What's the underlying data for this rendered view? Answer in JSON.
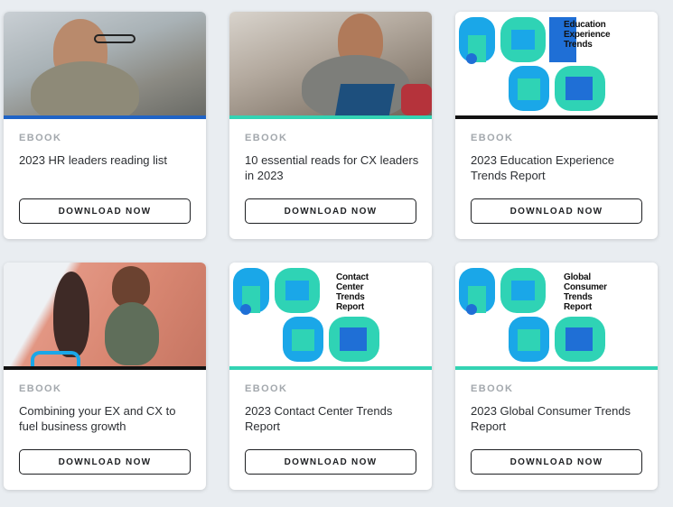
{
  "colors": {
    "accent_blue": "#1f63c6",
    "accent_teal": "#33d3b3",
    "accent_black": "#111111",
    "report_teal": "#2fd3b5",
    "report_blue": "#1aa7e8",
    "report_dark_blue": "#1f6fd6"
  },
  "cards": [
    {
      "eyebrow": "EBOOK",
      "title": "2023 HR leaders reading list",
      "button": "DOWNLOAD NOW",
      "image": "photo-man-laptop"
    },
    {
      "eyebrow": "EBOOK",
      "title": "10 essential reads for CX leaders in 2023",
      "button": "DOWNLOAD NOW",
      "image": "photo-man-reading"
    },
    {
      "eyebrow": "EBOOK",
      "title": "2023 Education Experience Trends Report",
      "button": "DOWNLOAD NOW",
      "image": "report-2023",
      "image_label": [
        "Education",
        "Experience",
        "Trends"
      ]
    },
    {
      "eyebrow": "EBOOK",
      "title": "Combining your EX and CX to fuel business growth",
      "button": "DOWNLOAD NOW",
      "image": "photo-shop-payment"
    },
    {
      "eyebrow": "EBOOK",
      "title": "2023 Contact Center Trends Report",
      "button": "DOWNLOAD NOW",
      "image": "report-2023",
      "image_label": [
        "Contact",
        "Center",
        "Trends",
        "Report"
      ]
    },
    {
      "eyebrow": "EBOOK",
      "title": "2023 Global Consumer Trends Report",
      "button": "DOWNLOAD NOW",
      "image": "report-2023",
      "image_label": [
        "Global",
        "Consumer",
        "Trends",
        "Report"
      ]
    }
  ]
}
